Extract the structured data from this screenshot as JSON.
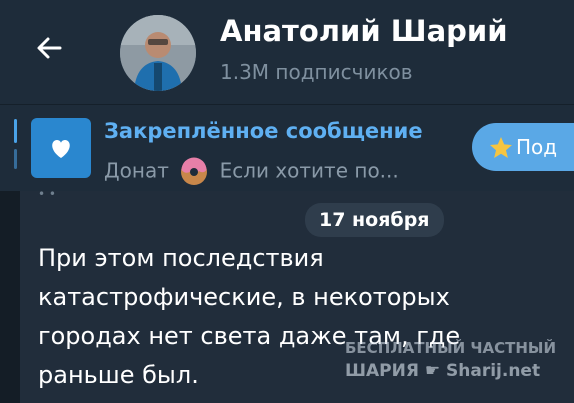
{
  "header": {
    "back_icon": "arrow-left-icon",
    "channel_name": "Анатолий Шарий",
    "subscribers": "1.3M подписчиков"
  },
  "pinned": {
    "title": "Закреплённое сообщение",
    "preview_prefix": "Донат",
    "preview_suffix": "Если хотите по...",
    "thumb_icon": "heart-icon",
    "emoji_icon": "donut-icon",
    "subscribe_label": "Под",
    "star_icon": "star-icon"
  },
  "message": {
    "date": "17 ноября",
    "lines": [
      "При этом последствия",
      "катастрофические, в некоторых",
      "городах нет света даже там, где",
      "раньше был."
    ]
  },
  "watermark": {
    "line1": "БЕСПЛАТНЫЙ ЧАСТНЫЙ",
    "line2": "ШАРИЯ ☛ Sharij.net"
  },
  "colors": {
    "background": "#18222d",
    "header": "#1e2c3a",
    "accent": "#5fb0f2",
    "bubble": "#212d3b"
  }
}
